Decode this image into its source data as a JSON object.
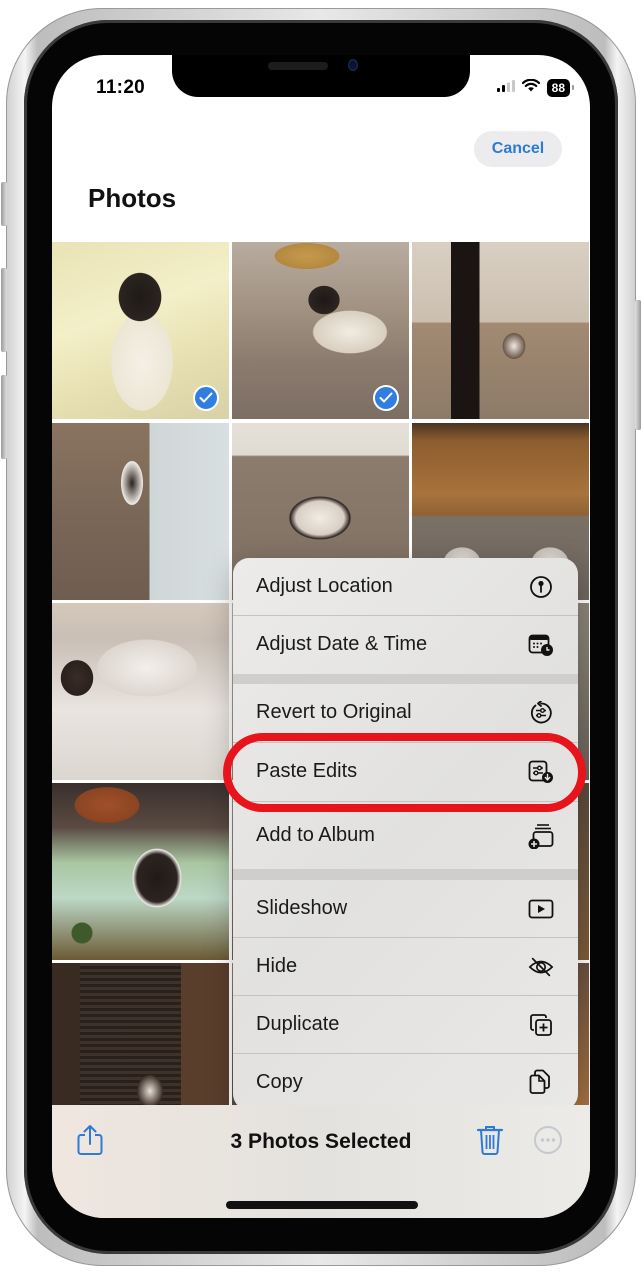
{
  "status_bar": {
    "time": "11:20",
    "battery": "88",
    "signal_icon": "cellular-signal-icon",
    "wifi_icon": "wifi-icon"
  },
  "header": {
    "cancel_label": "Cancel",
    "title": "Photos"
  },
  "grid": {
    "photos": [
      {
        "subject": "cat under yellow blanket",
        "selected": true
      },
      {
        "subject": "cat on couch blanket",
        "selected": true
      },
      {
        "subject": "cat in hallway",
        "selected": false
      },
      {
        "subject": "cat standing on carpet",
        "selected": false
      },
      {
        "subject": "cat lying on carpet",
        "selected": false
      },
      {
        "subject": "two cats under table",
        "selected": false
      },
      {
        "subject": "cats on fluffy rug",
        "selected": false
      },
      {
        "subject": "cat on floral bed",
        "selected": false
      },
      {
        "subject": "cat by window blinds",
        "selected": false
      }
    ]
  },
  "menu": {
    "groups": [
      [
        {
          "label": "Adjust Location",
          "icon": "location-pin-icon"
        },
        {
          "label": "Adjust Date & Time",
          "icon": "calendar-clock-icon"
        }
      ],
      [
        {
          "label": "Revert to Original",
          "icon": "revert-sliders-icon"
        },
        {
          "label": "Paste Edits",
          "icon": "paste-edits-icon",
          "highlighted": true
        },
        {
          "label": "Add to Album",
          "icon": "add-to-album-icon"
        }
      ],
      [
        {
          "label": "Slideshow",
          "icon": "play-icon"
        },
        {
          "label": "Hide",
          "icon": "eye-slash-icon"
        },
        {
          "label": "Duplicate",
          "icon": "duplicate-icon"
        },
        {
          "label": "Copy",
          "icon": "copy-icon"
        }
      ]
    ]
  },
  "annotation": {
    "highlight_target": "Paste Edits",
    "color": "#e8141c"
  },
  "toolbar": {
    "title": "3 Photos Selected",
    "share_icon": "share-icon",
    "trash_icon": "trash-icon",
    "more_icon": "more-ellipsis-icon"
  },
  "colors": {
    "accent": "#2f7bd4",
    "check_blue": "#2f7ee0",
    "annotation_red": "#e8141c"
  }
}
